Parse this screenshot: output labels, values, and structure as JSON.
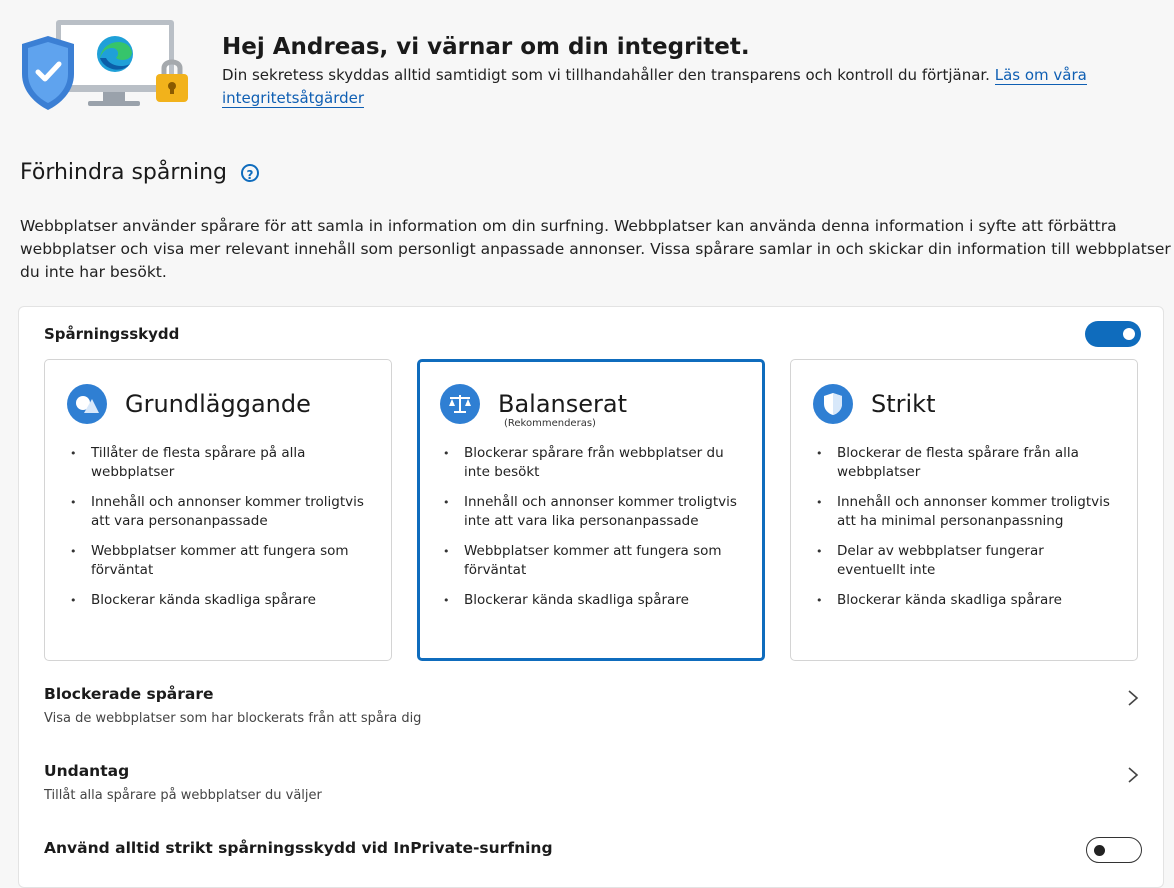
{
  "hero": {
    "title": "Hej Andreas, vi värnar om din integritet.",
    "description": "Din sekretess skyddas alltid samtidigt som vi tillhandahåller den transparens och kontroll du förtjänar.",
    "link_label": "Läs om våra integritetsåtgärder",
    "icons": [
      "shield-icon",
      "edge-logo",
      "lock-icon",
      "monitor-icon"
    ]
  },
  "section": {
    "title": "Förhindra spårning",
    "help_icon": "question-icon",
    "intro": "Webbplatser använder spårare för att samla in information om din surfning. Webbplatser kan använda denna information i syfte att förbättra webbplatser och visa mer relevant innehåll som personligt anpassade annonser. Vissa spårare samlar in och skickar din information till webbplatser du inte har besökt."
  },
  "tracking": {
    "label": "Spårningsskydd",
    "enabled": true,
    "options": [
      {
        "title": "Grundläggande",
        "subtitle": "",
        "icon": "basic-shapes-icon",
        "selected": false,
        "bullets": [
          "Tillåter de flesta spårare på alla webbplatser",
          "Innehåll och annonser kommer troligtvis att vara personanpassade",
          "Webbplatser kommer att fungera som förväntat",
          "Blockerar kända skadliga spårare"
        ]
      },
      {
        "title": "Balanserat",
        "subtitle": "(Rekommenderas)",
        "icon": "scales-icon",
        "selected": true,
        "bullets": [
          "Blockerar spårare från webbplatser du inte besökt",
          "Innehåll och annonser kommer troligtvis inte att vara lika personanpassade",
          "Webbplatser kommer att fungera som förväntat",
          "Blockerar kända skadliga spårare"
        ]
      },
      {
        "title": "Strikt",
        "subtitle": "",
        "icon": "shield-icon",
        "selected": false,
        "bullets": [
          "Blockerar de flesta spårare från alla webbplatser",
          "Innehåll och annonser kommer troligtvis att ha minimal personanpassning",
          "Delar av webbplatser fungerar eventuellt inte",
          "Blockerar kända skadliga spårare"
        ]
      }
    ]
  },
  "rows": {
    "blocked_title": "Blockerade spårare",
    "blocked_sub": "Visa de webbplatser som har blockerats från att spåra dig",
    "exceptions_title": "Undantag",
    "exceptions_sub": "Tillåt alla spårare på webbplatser du väljer",
    "inprivate_title": "Använd alltid strikt spårningsskydd vid InPrivate-surfning",
    "inprivate_enabled": false
  },
  "colors": {
    "accent": "#0f6cbd",
    "icon_blue": "#2f7fd3",
    "page_bg": "#f7f7f7",
    "lock_yellow": "#f2b21b"
  }
}
